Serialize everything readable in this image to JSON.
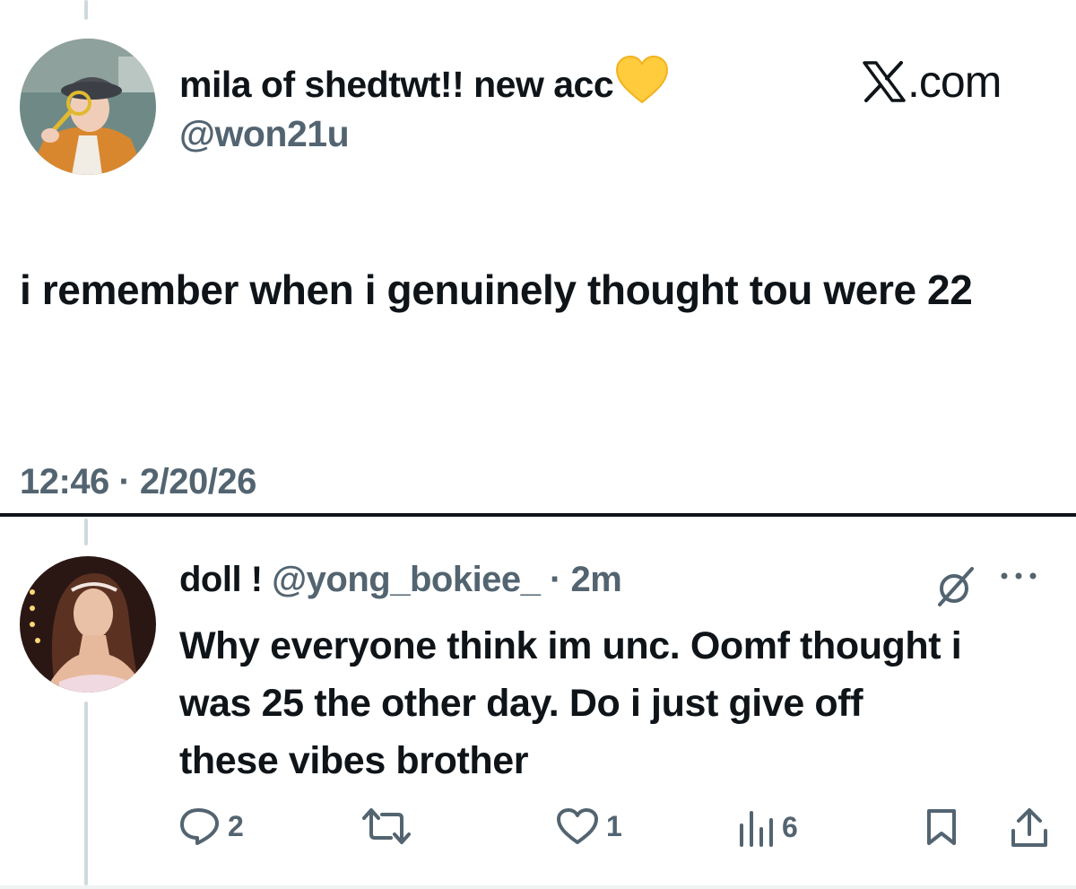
{
  "original_tweet": {
    "display_name": "mila of shedtwt!! new acc",
    "handle": "@won21u",
    "text": "i remember when i genuinely thought tou were 22",
    "time": "12:46 · 2/20/26",
    "avatar_icon": "person-with-magnifier-avatar"
  },
  "brand": {
    "logo_icon": "x-logo-icon",
    "domain": ".com"
  },
  "reply_tweet": {
    "display_name": "doll !",
    "handle": "@yong_bokiee_",
    "age": "· 2m",
    "text": "Why everyone think im unc. Oomf thought i was 25 the other day. Do i just give off these vibes brother",
    "avatar_icon": "woman-portrait-avatar",
    "actions": {
      "replies": "2",
      "reposts": "",
      "likes": "1",
      "views": "6"
    }
  },
  "colors": {
    "text": "#0f1419",
    "muted": "#536471",
    "thread_line": "#cfd9de",
    "heart": "#ffcc3d"
  }
}
